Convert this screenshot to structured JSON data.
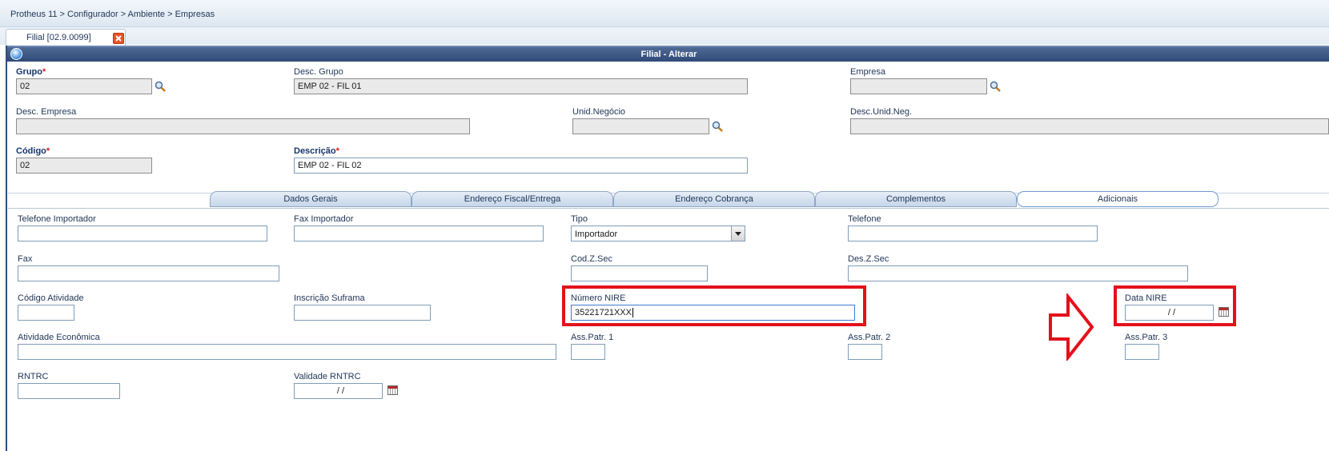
{
  "header": {
    "breadcrumb": "Protheus 11 > Configurador > Ambiente > Empresas"
  },
  "document_tab": {
    "label": "Filial [02.9.0099]"
  },
  "dialog": {
    "title": "Filial - Alterar"
  },
  "fields": {
    "grupo": {
      "label": "Grupo",
      "value": "02"
    },
    "desc_grupo": {
      "label": "Desc. Grupo",
      "value": "EMP 02 - FIL 01"
    },
    "empresa": {
      "label": "Empresa",
      "value": ""
    },
    "desc_empresa": {
      "label": "Desc. Empresa",
      "value": ""
    },
    "unid_negocio": {
      "label": "Unid.Negócio",
      "value": ""
    },
    "desc_unid_neg": {
      "label": "Desc.Unid.Neg.",
      "value": ""
    },
    "codigo": {
      "label": "Código",
      "value": "02"
    },
    "descricao": {
      "label": "Descrição",
      "value": "EMP 02 - FIL 02"
    }
  },
  "required_mark": "*",
  "folder_tabs": [
    {
      "label": "Dados Gerais"
    },
    {
      "label": "Endereço Fiscal/Entrega"
    },
    {
      "label": "Endereço Cobrança"
    },
    {
      "label": "Complementos"
    },
    {
      "label": "Adicionais",
      "active": true
    }
  ],
  "adicionais": {
    "telefone_importador": {
      "label": "Telefone Importador",
      "value": ""
    },
    "fax_importador": {
      "label": "Fax Importador",
      "value": ""
    },
    "tipo": {
      "label": "Tipo",
      "value": "Importador"
    },
    "telefone": {
      "label": "Telefone",
      "value": ""
    },
    "fax": {
      "label": "Fax",
      "value": ""
    },
    "cod_z_sec": {
      "label": "Cod.Z.Sec",
      "value": ""
    },
    "des_z_sec": {
      "label": "Des.Z.Sec",
      "value": ""
    },
    "codigo_atividade": {
      "label": "Código Atividade",
      "value": ""
    },
    "inscricao_suframa": {
      "label": "Inscrição Suframa",
      "value": ""
    },
    "numero_nire": {
      "label": "Número NIRE",
      "value": "35221721XXX"
    },
    "data_nire": {
      "label": "Data NIRE",
      "value": "/ /"
    },
    "atividade_economica": {
      "label": "Atividade Econômica",
      "value": ""
    },
    "ass_patr_1": {
      "label": "Ass.Patr. 1",
      "value": ""
    },
    "ass_patr_2": {
      "label": "Ass.Patr. 2",
      "value": ""
    },
    "ass_patr_3": {
      "label": "Ass.Patr. 3",
      "value": ""
    },
    "rntrc": {
      "label": "RNTRC",
      "value": ""
    },
    "validade_rntrc": {
      "label": "Validade RNTRC",
      "value": "/ /"
    }
  },
  "annotation": {
    "highlight_color": "#e3111b",
    "arrow": "right-arrow-outline"
  },
  "colors": {
    "titlebar": "#2f4a78",
    "required": "#e0121a",
    "label": "#15356b"
  },
  "icons": {
    "lookup": "magnifier-icon",
    "calendar": "calendar-icon",
    "close": "close-icon",
    "help": "help-icon"
  }
}
